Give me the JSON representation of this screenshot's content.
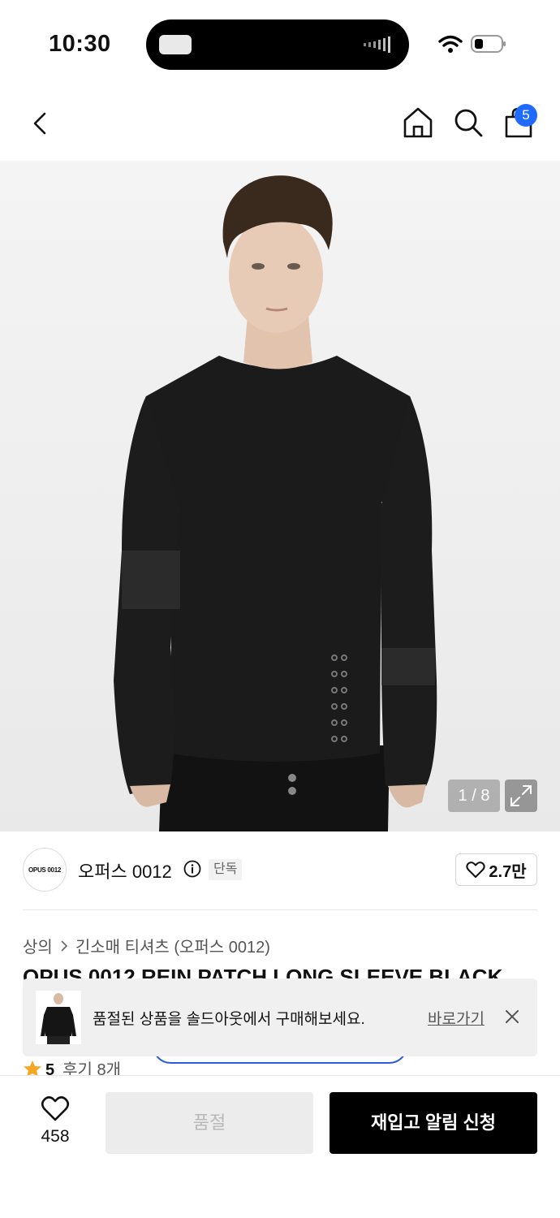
{
  "status_bar": {
    "time": "10:30",
    "icons": [
      "wifi-icon",
      "battery-icon"
    ]
  },
  "nav": {
    "icons": [
      "back-icon",
      "home-icon",
      "search-icon",
      "cart-icon"
    ],
    "cart_badge": "5"
  },
  "gallery": {
    "counter": "1 / 8",
    "expand_icon": "expand-icon"
  },
  "brand": {
    "logo_text": "OPUS 0012",
    "name": "오퍼스 0012",
    "exclusive_label": "단독",
    "likes": "2.7만"
  },
  "breadcrumb": {
    "category": "상의",
    "subcategory": "긴소매 티셔츠 (오퍼스 0012)"
  },
  "product": {
    "title": "OPUS 0012 REIN PATCH LONG SLEEVE BLACK",
    "rating": "5",
    "reviews": "후기 8개"
  },
  "toast": {
    "message": "품절된 상품을 솔드아웃에서 구매해보세요.",
    "link": "바로가기"
  },
  "bottom_bar": {
    "wishlist_count": "458",
    "soldout_label": "품절",
    "restock_label": "재입고 알림 신청"
  },
  "colors": {
    "accent_blue": "#1f6bff",
    "star": "#f5a623",
    "primary_button": "#000000",
    "disabled_button": "#ececec"
  }
}
